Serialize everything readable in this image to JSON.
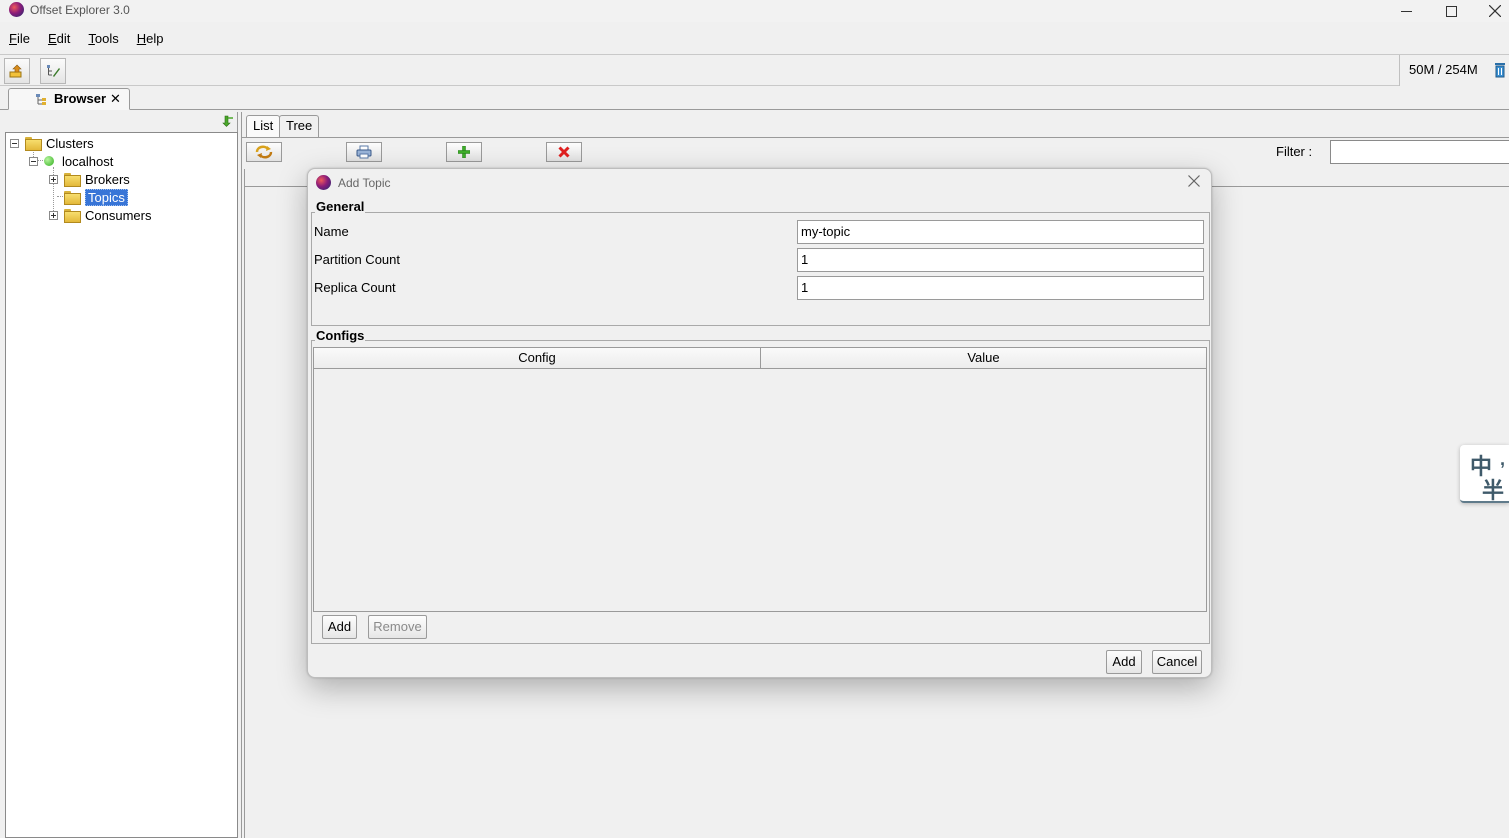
{
  "window": {
    "title": "Offset Explorer  3.0"
  },
  "menu": {
    "items": [
      {
        "mnemonic": "F",
        "rest": "ile"
      },
      {
        "mnemonic": "E",
        "rest": "dit"
      },
      {
        "mnemonic": "T",
        "rest": "ools"
      },
      {
        "mnemonic": "H",
        "rest": "elp"
      }
    ]
  },
  "toolbar": {
    "memory": "50M / 254M"
  },
  "browser_tab": {
    "label": "Browser",
    "close": "✕"
  },
  "tree": {
    "root": "Clusters",
    "cluster": "localhost",
    "children": [
      "Brokers",
      "Topics",
      "Consumers"
    ],
    "selected": "Topics"
  },
  "right": {
    "tabs": [
      "List",
      "Tree"
    ],
    "filter_label": "Filter :",
    "filter_value": ""
  },
  "ime": {
    "char1": "中",
    "char2": "半",
    "mark": ","
  },
  "dialog": {
    "title": "Add Topic",
    "general_legend": "General",
    "fields": [
      {
        "label": "Name",
        "value": "my-topic"
      },
      {
        "label": "Partition Count",
        "value": "1"
      },
      {
        "label": "Replica Count",
        "value": "1"
      }
    ],
    "configs_legend": "Configs",
    "columns": [
      "Config",
      "Value"
    ],
    "add_config": "Add",
    "remove_config": "Remove",
    "add": "Add",
    "cancel": "Cancel"
  }
}
